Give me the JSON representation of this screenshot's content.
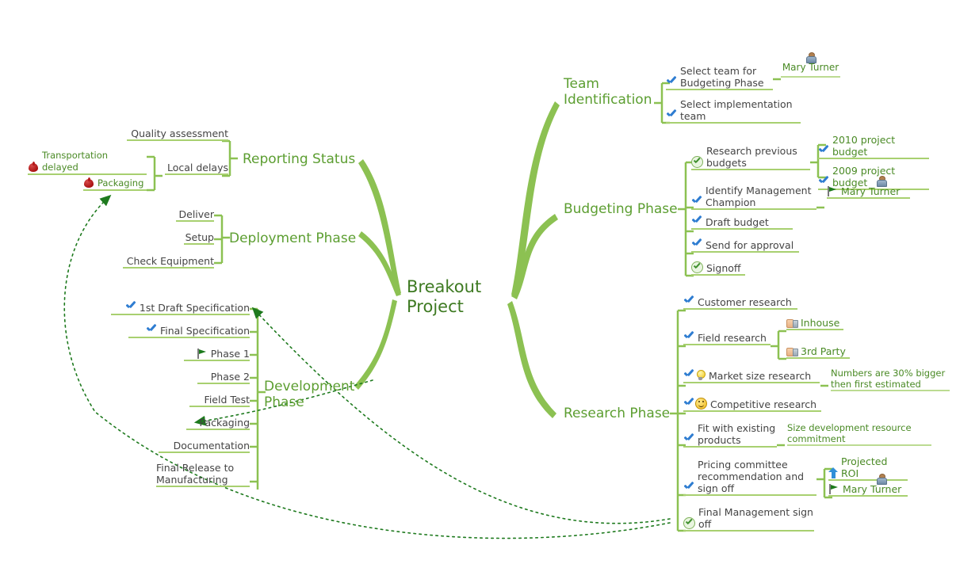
{
  "root": {
    "label": "Breakout\nProject"
  },
  "colors": {
    "branch": "#8CC152",
    "branch_label": "#5C9E31",
    "root_text": "#3E7A22",
    "leaf_text": "#444444",
    "green_text": "#4A8A25",
    "underline": "#A8D070",
    "check_blue": "#2F7DD1",
    "relation_line": "#1E7A1E",
    "alert_red": "#AA1313"
  },
  "branches": {
    "team_identification": {
      "label": "Team\nIdentification",
      "items": [
        {
          "text": "Select team for\nBudgeting Phase",
          "icons": [
            "check-blue-icon"
          ],
          "child": {
            "text": "Mary Turner",
            "icons": [
              "avatar-icon"
            ]
          }
        },
        {
          "text": "Select implementation\nteam",
          "icons": [
            "check-blue-icon"
          ]
        }
      ]
    },
    "budgeting_phase": {
      "label": "Budgeting Phase",
      "items": [
        {
          "text": "Research previous\nbudgets",
          "icons": [
            "ok-circle-icon"
          ],
          "children": [
            {
              "text": "2010 project budget",
              "icons": [
                "check-blue-icon"
              ]
            },
            {
              "text": "2009 project budget",
              "icons": [
                "check-blue-icon"
              ]
            }
          ]
        },
        {
          "text": "Identify Management\nChampion",
          "icons": [
            "check-blue-icon"
          ],
          "child": {
            "text": "Mary Turner",
            "icons": [
              "flag-icon",
              "avatar-icon"
            ]
          }
        },
        {
          "text": "Draft budget",
          "icons": [
            "check-blue-icon"
          ]
        },
        {
          "text": "Send for approval",
          "icons": [
            "check-blue-icon"
          ]
        },
        {
          "text": "Signoff",
          "icons": [
            "ok-circle-icon"
          ]
        }
      ]
    },
    "research_phase": {
      "label": "Research Phase",
      "items": [
        {
          "text": "Customer research",
          "icons": [
            "check-blue-icon"
          ]
        },
        {
          "text": "Field research",
          "icons": [
            "check-blue-icon"
          ],
          "children": [
            {
              "text": "Inhouse",
              "icons": [
                "thumbs-up-icon"
              ]
            },
            {
              "text": "3rd Party",
              "icons": [
                "thumbs-up-icon"
              ]
            }
          ]
        },
        {
          "text": "Market size research",
          "icons": [
            "check-blue-icon",
            "lightbulb-icon"
          ],
          "note": "Numbers are 30% bigger\nthen first estimated"
        },
        {
          "text": "Competitive research",
          "icons": [
            "check-blue-icon",
            "smiley-icon"
          ]
        },
        {
          "text": "Fit with existing\nproducts",
          "icons": [
            "check-blue-icon"
          ],
          "note": "Size development resource\ncommitment"
        },
        {
          "text": "Pricing committee\nrecommendation and\nsign off",
          "icons": [
            "check-blue-icon"
          ],
          "children": [
            {
              "text": "Projected ROI",
              "icons": [
                "up-arrow-icon"
              ]
            },
            {
              "text": "Mary Turner",
              "icons": [
                "flag-icon",
                "avatar-icon"
              ]
            }
          ]
        },
        {
          "text": "Final Management sign\noff",
          "icons": [
            "ok-circle-icon"
          ],
          "relation_target": true
        }
      ]
    },
    "reporting_status": {
      "label": "Reporting Status",
      "items": [
        {
          "text": "Quality assessment",
          "icons": []
        },
        {
          "text": "Local delays",
          "icons": [],
          "children": [
            {
              "text": "Transportation delayed",
              "icons": [
                "red-drop-icon"
              ],
              "green": true
            },
            {
              "text": "Packaging",
              "icons": [
                "red-drop-icon"
              ],
              "green": true,
              "relation_target": true
            }
          ]
        }
      ]
    },
    "deployment_phase": {
      "label": "Deployment Phase",
      "items": [
        {
          "text": "Deliver",
          "icons": []
        },
        {
          "text": "Setup",
          "icons": []
        },
        {
          "text": "Check Equipment",
          "icons": []
        }
      ]
    },
    "development_phase": {
      "label": "Development\nPhase",
      "items": [
        {
          "text": "1st Draft Specification",
          "icons": [
            "check-blue-icon"
          ],
          "relation_target": true
        },
        {
          "text": "Final Specification",
          "icons": [
            "check-blue-icon"
          ]
        },
        {
          "text": "Phase 1",
          "icons": [
            "flag-icon"
          ]
        },
        {
          "text": "Phase 2",
          "icons": []
        },
        {
          "text": "Field Test",
          "icons": []
        },
        {
          "text": "Packaging",
          "icons": [],
          "relation_target": true
        },
        {
          "text": "Documentation",
          "icons": []
        },
        {
          "text": "Final Release to\nManufacturing",
          "icons": []
        }
      ]
    }
  },
  "relations": [
    {
      "from": "Final Management sign off",
      "to": "Packaging (Development Phase)"
    },
    {
      "from": "Final Management sign off",
      "to": "Packaging (Reporting Status)"
    },
    {
      "from": "Final Management sign off",
      "to": "1st Draft Specification"
    }
  ]
}
